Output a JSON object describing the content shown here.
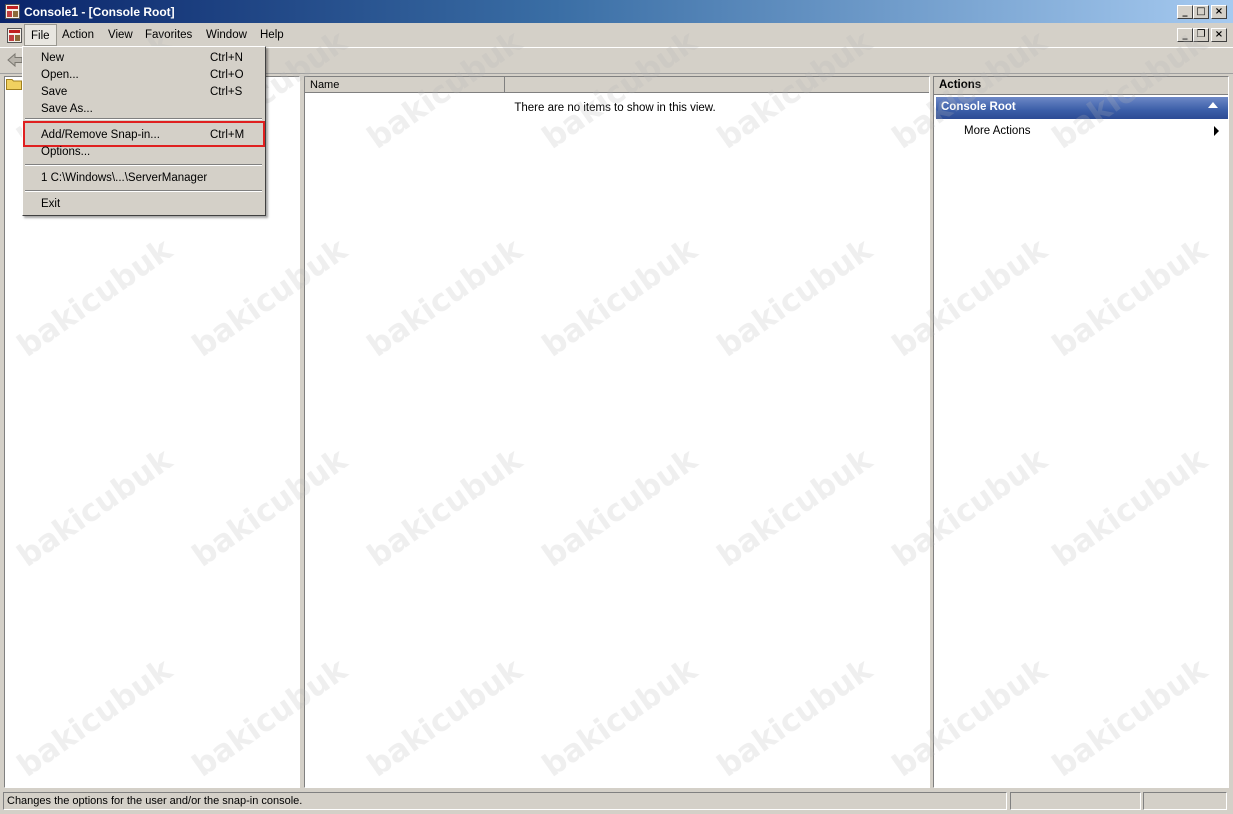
{
  "window": {
    "title": "Console1 - [Console Root]",
    "app_icon": "mmc-console-icon",
    "caption_buttons": {
      "minimize": "_",
      "maximize": "□",
      "close": "×"
    },
    "child_caption_buttons": {
      "minimize": "_",
      "restore": "❐",
      "close": "×"
    }
  },
  "menubar": {
    "items": [
      "File",
      "Action",
      "View",
      "Favorites",
      "Window",
      "Help"
    ]
  },
  "file_menu": {
    "items": [
      {
        "label": "New",
        "shortcut": "Ctrl+N"
      },
      {
        "label": "Open...",
        "shortcut": "Ctrl+O"
      },
      {
        "label": "Save",
        "shortcut": "Ctrl+S"
      },
      {
        "label": "Save As...",
        "shortcut": ""
      },
      {
        "label": "Add/Remove Snap-in...",
        "shortcut": "Ctrl+M",
        "highlighted": true
      },
      {
        "label": "Options...",
        "shortcut": ""
      },
      {
        "label": "1 C:\\Windows\\...\\ServerManager",
        "shortcut": ""
      },
      {
        "label": "Exit",
        "shortcut": ""
      }
    ]
  },
  "result_pane": {
    "columns": [
      "Name"
    ],
    "empty_message": "There are no items to show in this view."
  },
  "actions_pane": {
    "header": "Actions",
    "section_title": "Console Root",
    "items": [
      "More Actions"
    ]
  },
  "statusbar": {
    "text": "Changes the options for the user and/or the snap-in console."
  },
  "watermark": "bakicubuk",
  "colors": {
    "title_gradient_start": "#0a246a",
    "title_gradient_end": "#a6caf0",
    "actions_section": "#3b5ea8",
    "highlight_box": "#e02020",
    "chrome": "#d4d0c8"
  }
}
